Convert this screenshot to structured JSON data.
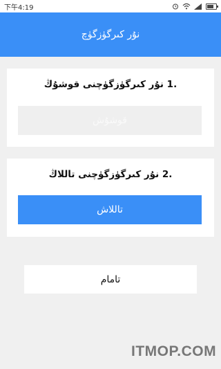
{
  "status": {
    "time": "下午4:19"
  },
  "header": {
    "title": "نۇر كىرگۈزگۈچ"
  },
  "step1": {
    "number": "1.",
    "title": "نۇر كىرگۈزگۈچنى قوشۇڭ",
    "button": "قوشۇش"
  },
  "step2": {
    "number": "2.",
    "title": "نۇر كىرگۈزگۈچنى تاللاڭ",
    "button": "تاللاش"
  },
  "done_button": "تامام",
  "watermark": "ITMOP.COM",
  "colors": {
    "accent": "#3a8ff7",
    "background": "#f0f0f0"
  }
}
